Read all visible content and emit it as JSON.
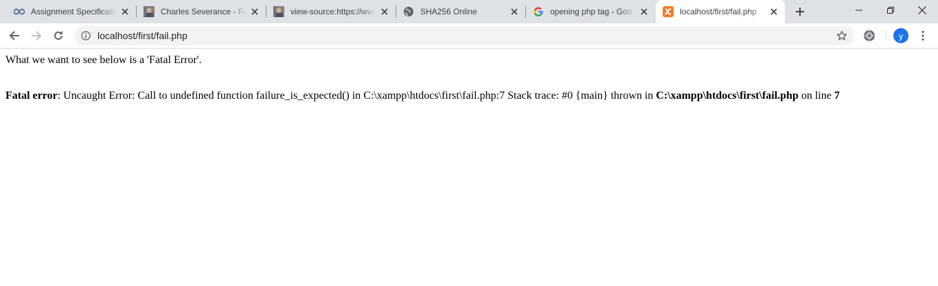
{
  "browser": {
    "tabs": [
      {
        "title": "Assignment Specification",
        "favicon": "infinity-icon",
        "active": false
      },
      {
        "title": "Charles Severance - Rec",
        "favicon": "profile-photo-icon",
        "active": false
      },
      {
        "title": "view-source:https://www",
        "favicon": "profile-photo-icon",
        "active": false
      },
      {
        "title": "SHA256 Online",
        "favicon": "globe-icon",
        "active": false
      },
      {
        "title": "opening php tag - Goo",
        "favicon": "google-icon",
        "active": false
      },
      {
        "title": "localhost/first/fail.php",
        "favicon": "xampp-icon",
        "active": true
      }
    ],
    "url": "localhost/first/fail.php",
    "profile_initial": "y",
    "accent_color": "#1a73e8"
  },
  "page": {
    "intro": "What we want to see below is a 'Fatal Error'.",
    "error": {
      "label": "Fatal error",
      "message": ": Uncaught Error: Call to undefined function failure_is_expected() in C:\\xampp\\htdocs\\first\\fail.php:7 Stack trace: #0 {main} thrown in ",
      "file": "C:\\xampp\\htdocs\\first\\fail.php",
      "on_line_text": " on line ",
      "line": "7"
    }
  }
}
